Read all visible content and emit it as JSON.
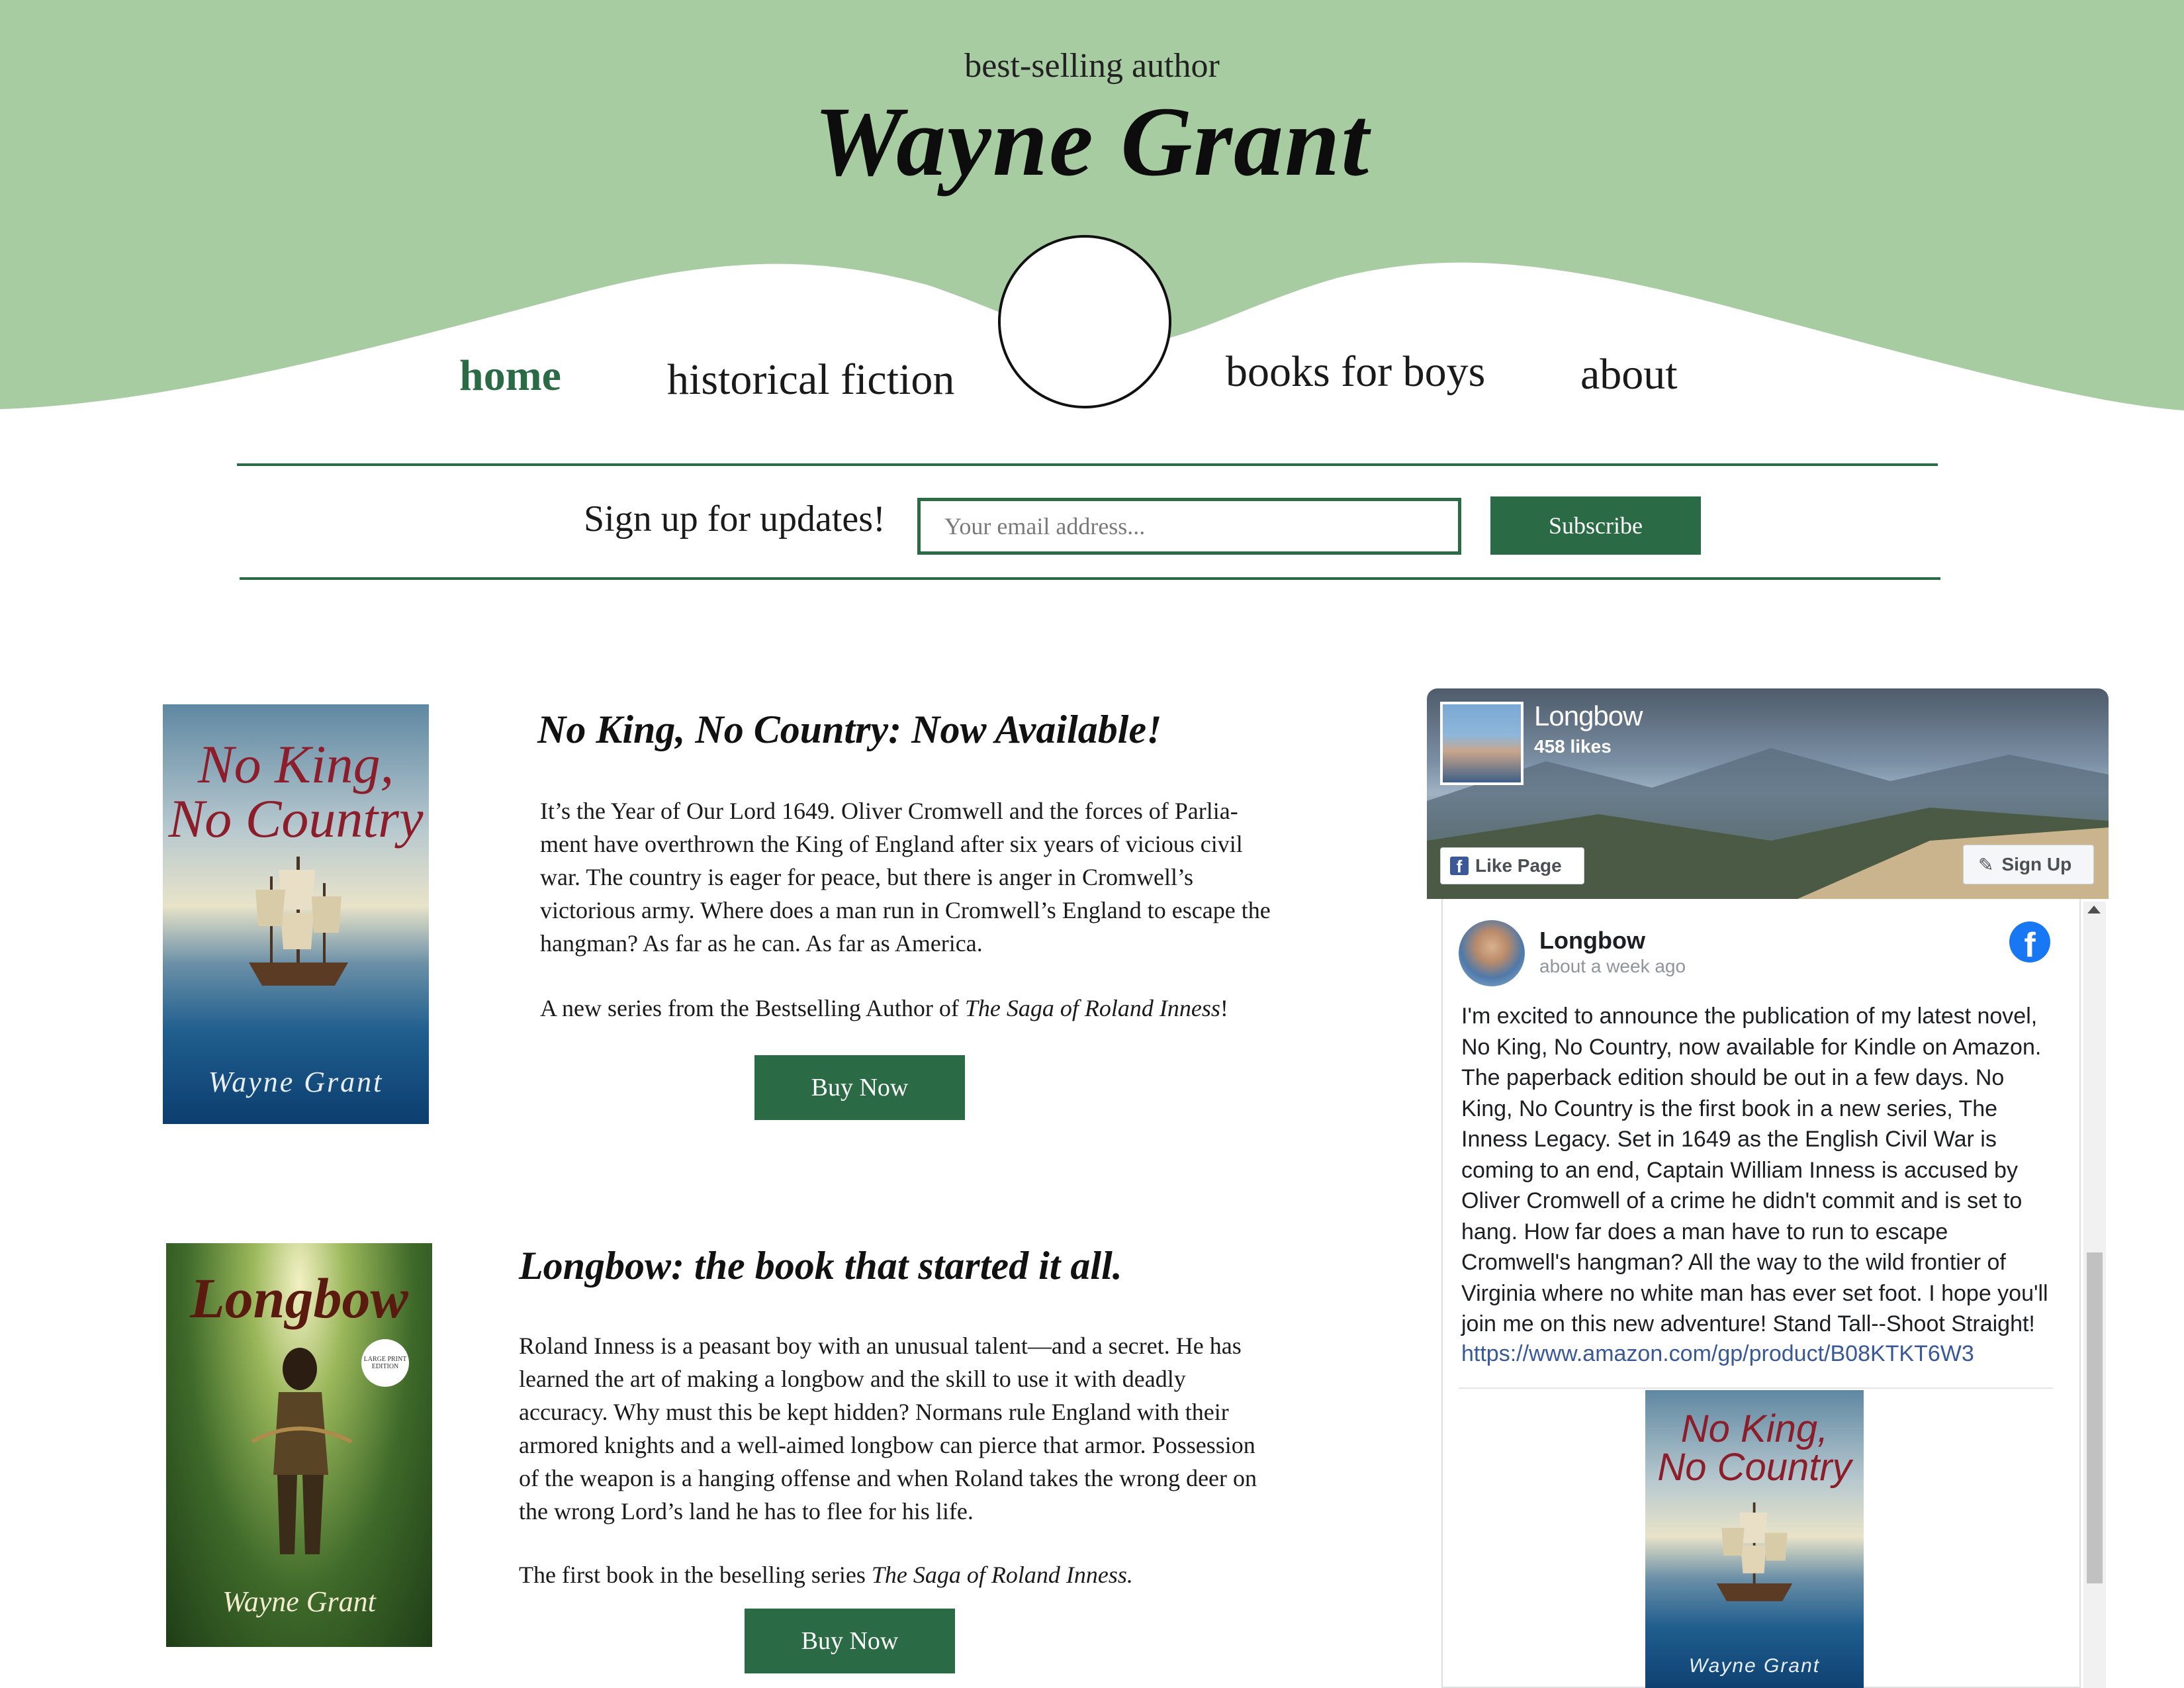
{
  "header": {
    "tagline": "best-selling author",
    "title": "Wayne Grant",
    "background_color": "#a8cca1",
    "accent_color": "#2a6b45"
  },
  "nav": {
    "items": [
      {
        "label": "home",
        "active": true
      },
      {
        "label": "historical fiction",
        "active": false
      },
      {
        "label": "books for boys",
        "active": false
      },
      {
        "label": "about",
        "active": false
      }
    ]
  },
  "signup": {
    "label": "Sign up for updates!",
    "placeholder": "Your email address...",
    "button": "Subscribe"
  },
  "books": [
    {
      "cover_title_line1": "No King,",
      "cover_title_line2": "No Country",
      "cover_author": "Wayne Grant",
      "heading": "No King, No Country: Now Available!",
      "description": "It’s the Year of Our Lord 1649. Oliver Cromwell and the forces of Parlia-ment have overthrown the King of England after six years of vicious civil war. The country is eager for peace, but there is anger in Cromwell’s victorious army.  Where does a man run in Cromwell’s England to escape the hangman? As far as he can. As far as America.",
      "series_prefix": "A new series from the Bestselling Author of ",
      "series_italic": "The Saga of Roland Inness",
      "series_suffix": "!",
      "button": "Buy Now"
    },
    {
      "cover_title": "Longbow",
      "cover_badge": "LARGE PRINT EDITION",
      "cover_author": "Wayne Grant",
      "heading": "Longbow: the book that started it all.",
      "description": "Roland Inness is a peasant boy with an unusual talent—and a secret. He has learned the art of making a longbow and the skill to use it with deadly accuracy. Why must this be kept hidden? Normans rule England with their armored knights and a well-aimed longbow can pierce that armor. Possession of the weapon is a hanging offense and when Roland takes the wrong deer on the wrong Lord’s land he has to flee for his life.",
      "series_prefix": "The first book in the beselling series ",
      "series_italic": "The Saga of Roland Inness.",
      "series_suffix": "",
      "button": "Buy Now"
    }
  ],
  "facebook": {
    "page_name": "Longbow",
    "likes": "458 likes",
    "like_button": "Like Page",
    "signup_button": "Sign Up",
    "post": {
      "author": "Longbow",
      "time": "about a week ago",
      "text": "I'm excited to announce the publication of my latest novel, No King, No Country, now available for Kindle on Amazon. The paperback edition should be out in a few days. No King, No Country is the first book in a new series, The Inness Legacy. Set in 1649 as the English Civil War is coming to an end, Captain William Inness is accused by Oliver Cromwell of a crime he didn't commit and is set to hang. How far does a man have to run to escape Cromwell's hangman? All the way to the wild frontier of Virginia where no white man has ever set foot. I hope you'll join me on this new adventure! Stand Tall--Shoot Straight!",
      "link": "https://www.amazon.com/gp/product/B08KTKT6W3"
    },
    "brand_color": "#1877f2"
  },
  "icons": [
    "facebook-logo-icon",
    "facebook-f-icon",
    "pencil-icon",
    "scroll-up-arrow-icon"
  ]
}
